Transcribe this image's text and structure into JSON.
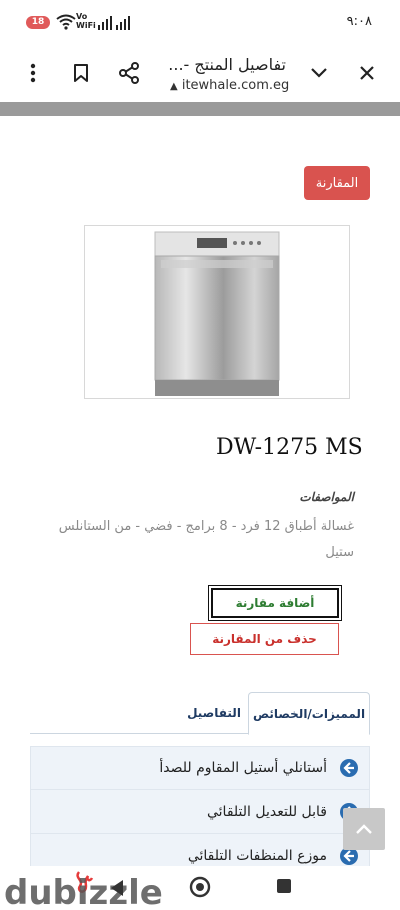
{
  "status": {
    "time": "٩:٠٨",
    "badge": "18",
    "network_vo": "Vo",
    "network_wifi": "WiFi"
  },
  "browser": {
    "title": "تفاصيل المنتج -...",
    "url": "itewhale.com.eg"
  },
  "page": {
    "compare_button": "المقارنة",
    "model": "DW-1275 MS",
    "specs_label": "المواصفات",
    "specs_text": "غسالة أطباق 12 فرد - 8 برامج - فضي - من الستانلس ستيل",
    "add_compare": "أضافة مقارنة",
    "remove_compare": "حذف من المقارنة",
    "tabs": [
      {
        "label": "المميزات/الخصائص",
        "active": true
      },
      {
        "label": "التفاصيل",
        "active": false
      }
    ],
    "features": [
      {
        "text": "أستانلي أستيل المقاوم للصدأ"
      },
      {
        "text": "قابل للتعديل التلقائي"
      },
      {
        "text": "موزع المنظفات التلقائي"
      }
    ]
  },
  "watermark": {
    "logo_text": "dubizzle"
  },
  "colors": {
    "accent_red": "#d9534f",
    "tab_text": "#1f3b63",
    "feature_bg": "#eef3f9"
  }
}
